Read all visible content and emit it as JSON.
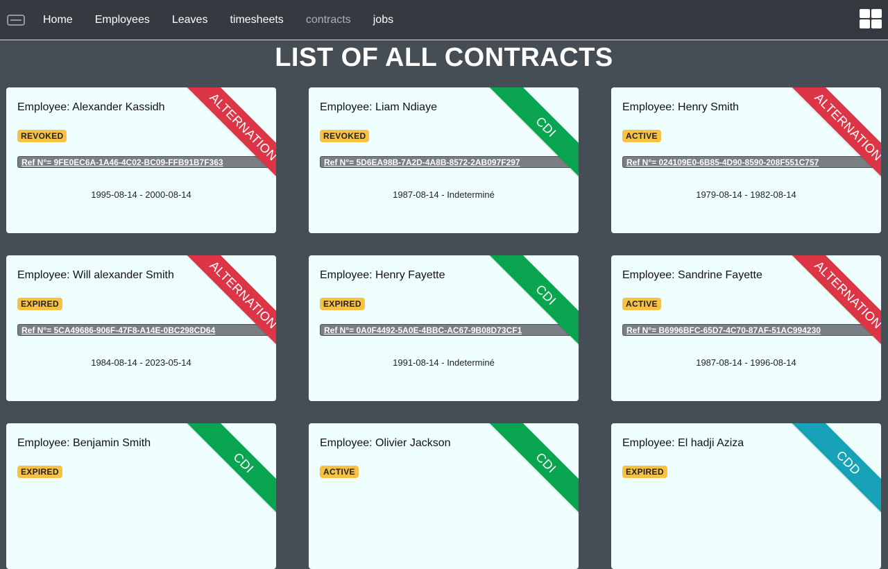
{
  "nav": {
    "items": [
      {
        "label": "Home"
      },
      {
        "label": "Employees"
      },
      {
        "label": "Leaves"
      },
      {
        "label": "timesheets"
      },
      {
        "label": "contracts"
      },
      {
        "label": "jobs"
      }
    ]
  },
  "page": {
    "title": "LIST OF ALL CONTRACTS"
  },
  "cards": [
    {
      "employee": "Employee: Alexander Kassidh",
      "status": "REVOKED",
      "ref": "Ref N°= 9FE0EC6A-1A46-4C02-BC09-FFB91B7F363",
      "dates": "1995-08-14 - 2000-08-14",
      "type": "ALTERNATION"
    },
    {
      "employee": "Employee: Liam Ndiaye",
      "status": "REVOKED",
      "ref": "Ref N°= 5D6EA98B-7A2D-4A8B-8572-2AB097F297",
      "dates": "1987-08-14 - Indeterminé",
      "type": "CDI"
    },
    {
      "employee": "Employee: Henry Smith",
      "status": "ACTIVE",
      "ref": "Ref N°= 024109E0-6B85-4D90-8590-208F551C757",
      "dates": "1979-08-14 - 1982-08-14",
      "type": "ALTERNATION"
    },
    {
      "employee": "Employee: Will alexander Smith",
      "status": "EXPIRED",
      "ref": "Ref N°= 5CA49686-906F-47F8-A14E-0BC298CD64",
      "dates": "1984-08-14 - 2023-05-14",
      "type": "ALTERNATION"
    },
    {
      "employee": "Employee: Henry Fayette",
      "status": "EXPIRED",
      "ref": "Ref N°= 0A0F4492-5A0E-4BBC-AC67-9B08D73CF1",
      "dates": "1991-08-14 - Indeterminé",
      "type": "CDI"
    },
    {
      "employee": "Employee: Sandrine Fayette",
      "status": "ACTIVE",
      "ref": "Ref N°= B6996BFC-65D7-4C70-87AF-51AC994230",
      "dates": "1987-08-14 - 1996-08-14",
      "type": "ALTERNATION"
    },
    {
      "employee": "Employee: Benjamin Smith",
      "status": "EXPIRED",
      "ref": "",
      "dates": "",
      "type": "CDI"
    },
    {
      "employee": "Employee: Olivier Jackson",
      "status": "ACTIVE",
      "ref": "",
      "dates": "",
      "type": "CDI"
    },
    {
      "employee": "Employee: El hadji Aziza",
      "status": "EXPIRED",
      "ref": "",
      "dates": "",
      "type": "CDD"
    }
  ],
  "colors": {
    "navbar": "#343a40",
    "background": "#454d55",
    "card": "#effffd",
    "badge": "#f6c145",
    "ribbon_alternation": "#dc3545",
    "ribbon_cdi": "#0aa551",
    "ribbon_cdd": "#17a2b8"
  },
  "icons": {
    "brand": "logo-icon",
    "menu": "grid-menu-icon"
  }
}
